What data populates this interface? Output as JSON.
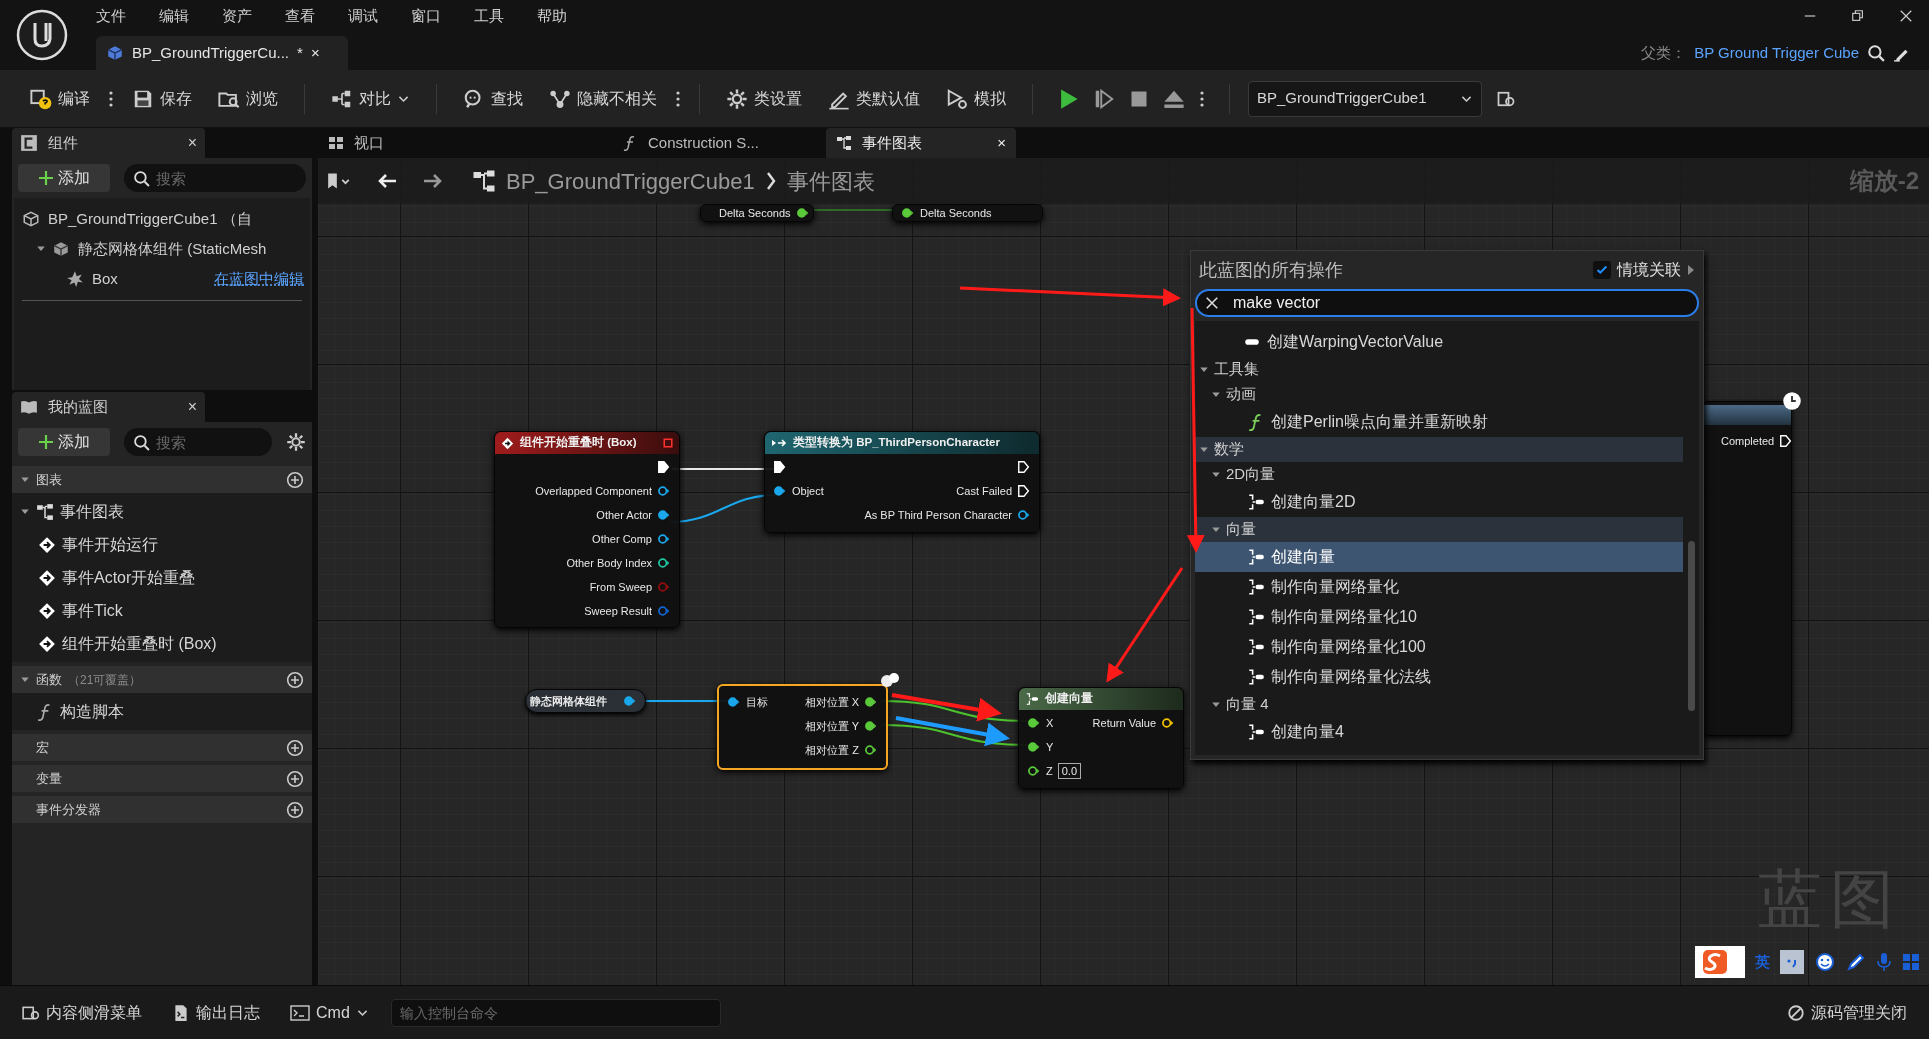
{
  "menu_bar": [
    {
      "label": "文件"
    },
    {
      "label": "编辑"
    },
    {
      "label": "资产"
    },
    {
      "label": "查看"
    },
    {
      "label": "调试"
    },
    {
      "label": "窗口"
    },
    {
      "label": "工具"
    },
    {
      "label": "帮助"
    }
  ],
  "document_tab": {
    "title": "BP_GroundTriggerCu...",
    "modified_mark": "*",
    "close": "×"
  },
  "parent_class": {
    "label": "父类：",
    "value": "BP Ground Trigger Cube"
  },
  "toolbar": [
    {
      "kind": "button",
      "label": "编译",
      "menu": true
    },
    {
      "kind": "button",
      "label": "保存",
      "menu": false
    },
    {
      "kind": "button",
      "label": "浏览",
      "menu": false
    },
    {
      "kind": "dropdown_button",
      "label": "对比",
      "menu": false
    },
    {
      "kind": "button",
      "label": "查找",
      "menu": false
    },
    {
      "kind": "button",
      "label": "隐藏不相关",
      "menu": true
    },
    {
      "kind": "button",
      "label": "类设置",
      "menu": false
    },
    {
      "kind": "button",
      "label": "类默认值",
      "menu": false
    },
    {
      "kind": "button",
      "label": "模拟",
      "menu": false
    },
    {
      "kind": "play_controls"
    },
    {
      "kind": "select",
      "label": "BP_GroundTriggerCube1"
    },
    {
      "kind": "icon_button"
    }
  ],
  "components_panel": {
    "title": "组件",
    "close": "×",
    "add_label": "添加",
    "search_placeholder": "搜索",
    "tree": [
      {
        "kind": "actor",
        "label": "BP_GroundTriggerCube1 （自",
        "children": [
          {
            "kind": "mesh",
            "label": "静态网格体组件 (StaticMesh",
            "expanded": true,
            "children": [
              {
                "kind": "collision",
                "label": "Box",
                "link": "在蓝图中编辑"
              }
            ]
          }
        ]
      }
    ]
  },
  "my_blueprint": {
    "title": "我的蓝图",
    "close": "×",
    "add_label": "添加",
    "search_placeholder": "搜索",
    "sections": [
      {
        "title": "图表",
        "expanded": true,
        "items": [
          {
            "kind": "graph",
            "label": "事件图表",
            "expanded": true,
            "children": [
              {
                "kind": "event",
                "label": "事件开始运行"
              },
              {
                "kind": "event",
                "label": "事件Actor开始重叠"
              },
              {
                "kind": "event",
                "label": "事件Tick"
              },
              {
                "kind": "event",
                "label": "组件开始重叠时 (Box)"
              }
            ]
          }
        ]
      },
      {
        "title": "函数",
        "count": "（21可覆盖）",
        "expanded": true,
        "items": [
          {
            "kind": "function",
            "label": "构造脚本"
          }
        ]
      },
      {
        "title": "宏",
        "expanded": false
      },
      {
        "title": "变量",
        "expanded": false
      },
      {
        "title": "事件分发器",
        "expanded": false
      }
    ]
  },
  "graph_tabs": [
    {
      "label": "视口",
      "selected": false
    },
    {
      "label": "Construction S...",
      "selected": false
    },
    {
      "label": "事件图表",
      "selected": true,
      "close": "×"
    }
  ],
  "breadcrumb": {
    "path": [
      "BP_GroundTriggerCube1",
      "事件图表"
    ]
  },
  "zoom_label": "缩放-2",
  "graph_label": "蓝图",
  "nodes": [
    {
      "kind": "partial",
      "selected": false,
      "rows": [
        {
          "right": {
            "kind": "data",
            "label": "Delta Seconds",
            "color": "#5ac93a",
            "connected": true
          }
        }
      ]
    },
    {
      "kind": "partial",
      "selected": false,
      "rows": [
        {
          "left": {
            "kind": "data",
            "label": "Delta Seconds",
            "color": "#5ac93a",
            "connected": true
          }
        }
      ]
    },
    {
      "kind": "event",
      "title": "组件开始重叠时 (Box)",
      "selected": false,
      "rows": [
        {
          "right": {
            "kind": "exec",
            "connected": true
          }
        },
        {
          "right": {
            "kind": "data",
            "label": "Overlapped Component",
            "color": "#1aa7ec",
            "connected": false
          }
        },
        {
          "right": {
            "kind": "data",
            "label": "Other Actor",
            "color": "#1aa7ec",
            "connected": true
          }
        },
        {
          "right": {
            "kind": "data",
            "label": "Other Comp",
            "color": "#1aa7ec",
            "connected": false
          }
        },
        {
          "right": {
            "kind": "data",
            "label": "Other Body Index",
            "color": "#1fc7a3",
            "connected": false
          }
        },
        {
          "right": {
            "kind": "data",
            "label": "From Sweep",
            "color": "#950c0c",
            "connected": false
          }
        },
        {
          "right": {
            "kind": "data",
            "label": "Sweep Result",
            "color": "#1166d6",
            "connected": false
          }
        }
      ]
    },
    {
      "kind": "cast",
      "title": "类型转换为 BP_ThirdPersonCharacter",
      "selected": false,
      "rows": [
        {
          "left": {
            "kind": "exec",
            "connected": true
          },
          "right": {
            "kind": "exec",
            "connected": false
          }
        },
        {
          "left": {
            "kind": "data",
            "label": "Object",
            "color": "#1aa7ec",
            "connected": true
          },
          "right": {
            "kind": "exec",
            "label": "Cast Failed",
            "connected": false
          }
        },
        {
          "right": {
            "kind": "data",
            "label": "As BP Third Person Character",
            "color": "#1aa7ec",
            "connected": false
          }
        }
      ]
    },
    {
      "kind": "variable",
      "label": "静态网格体组件",
      "selected": false,
      "rows": [
        {
          "right": {
            "kind": "data",
            "color": "#1aa7ec",
            "connected": true
          }
        }
      ]
    },
    {
      "kind": "getter",
      "selected": true,
      "rows": [
        {
          "left": {
            "kind": "data",
            "label": "目标",
            "color": "#1aa7ec",
            "connected": true
          },
          "right": {
            "kind": "data",
            "label": "相对位置 X",
            "color": "#5ac93a",
            "connected": true
          }
        },
        {
          "right": {
            "kind": "data",
            "label": "相对位置 Y",
            "color": "#5ac93a",
            "connected": true
          }
        },
        {
          "right": {
            "kind": "data",
            "label": "相对位置 Z",
            "color": "#5ac93a",
            "connected": false
          }
        }
      ]
    },
    {
      "kind": "make",
      "title": "创建向量",
      "selected": false,
      "rows": [
        {
          "left": {
            "kind": "data",
            "label": "X",
            "color": "#5ac93a",
            "connected": true
          },
          "right": {
            "kind": "data",
            "label": "Return Value",
            "color": "#f2c200",
            "connected": false
          }
        },
        {
          "left": {
            "kind": "data",
            "label": "Y",
            "color": "#5ac93a",
            "connected": true
          }
        },
        {
          "left": {
            "kind": "data",
            "label": "Z",
            "color": "#5ac93a",
            "connected": false,
            "value": "0.0"
          }
        }
      ]
    },
    {
      "kind": "latent",
      "selected": false,
      "rows": [
        {
          "right": {
            "kind": "exec",
            "label": "Completed",
            "connected": false
          }
        }
      ]
    }
  ],
  "context_menu": {
    "title": "此蓝图的所有操作",
    "context_sensitive": {
      "label": "情境关联",
      "checked": true
    },
    "search": {
      "value": "make vector"
    },
    "items": [
      {
        "kind": "struct",
        "label": "创建WarpingVectorValue",
        "selected": false
      },
      {
        "kind": "category",
        "label": "工具集",
        "expanded": true,
        "highlighted": false,
        "children": [
          {
            "kind": "category",
            "label": "动画",
            "expanded": true,
            "highlighted": false,
            "children": [
              {
                "kind": "function",
                "label": "创建Perlin噪点向量并重新映射",
                "selected": false
              }
            ]
          }
        ]
      },
      {
        "kind": "category",
        "label": "数学",
        "expanded": true,
        "highlighted": true,
        "children": [
          {
            "kind": "category",
            "label": "2D向量",
            "expanded": true,
            "highlighted": false,
            "children": [
              {
                "kind": "make",
                "label": "创建向量2D",
                "selected": false
              }
            ]
          },
          {
            "kind": "category",
            "label": "向量",
            "expanded": true,
            "highlighted": true,
            "children": [
              {
                "kind": "make",
                "label": "创建向量",
                "selected": true
              },
              {
                "kind": "make",
                "label": "制作向量网络量化",
                "selected": false
              },
              {
                "kind": "make",
                "label": "制作向量网络量化10",
                "selected": false
              },
              {
                "kind": "make",
                "label": "制作向量网络量化100",
                "selected": false
              },
              {
                "kind": "make",
                "label": "制作向量网络量化法线",
                "selected": false
              }
            ]
          },
          {
            "kind": "category",
            "label": "向量 4",
            "expanded": true,
            "highlighted": false,
            "children": [
              {
                "kind": "make",
                "label": "创建向量4",
                "selected": false
              }
            ]
          }
        ]
      }
    ]
  },
  "ime_toolbar": {
    "mode": "英"
  },
  "bottom_bar": {
    "items": [
      {
        "label": "内容侧滑菜单"
      },
      {
        "label": "输出日志"
      }
    ],
    "console": {
      "label": "Cmd",
      "placeholder": "输入控制台命令"
    },
    "source_control": "源码管理关闭"
  }
}
